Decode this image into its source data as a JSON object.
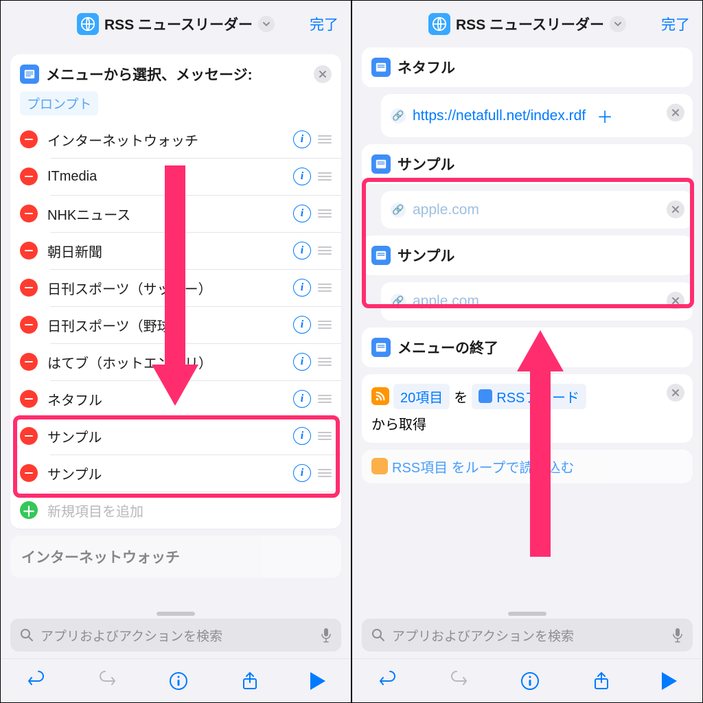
{
  "header": {
    "title": "RSS ニュースリーダー",
    "done": "完了"
  },
  "search_placeholder": "アプリおよびアクションを検索",
  "left": {
    "menu_head": "メニューから選択、メッセージ:",
    "prompt": "プロンプト",
    "items": [
      "インターネットウォッチ",
      "ITmedia",
      "NHKニュース",
      "朝日新聞",
      "日刊スポーツ（サッカー）",
      "日刊スポーツ（野球）",
      "はてブ（ホットエントリ）",
      "ネタフル",
      "サンプル",
      "サンプル"
    ],
    "add_item": "新規項目を追加",
    "peek": "インターネットウォッチ"
  },
  "right": {
    "netafull_title": "ネタフル",
    "netafull_url": "https://netafull.net/index.rdf",
    "sample_title": "サンプル",
    "sample_url_placeholder": "apple.com",
    "menu_end": "メニューの終了",
    "rss": {
      "count": "20項目",
      "wo": "を",
      "feed": "RSSフィード",
      "from": "から取得"
    },
    "bottom_peek": "RSS項目  をループで読み込む"
  }
}
